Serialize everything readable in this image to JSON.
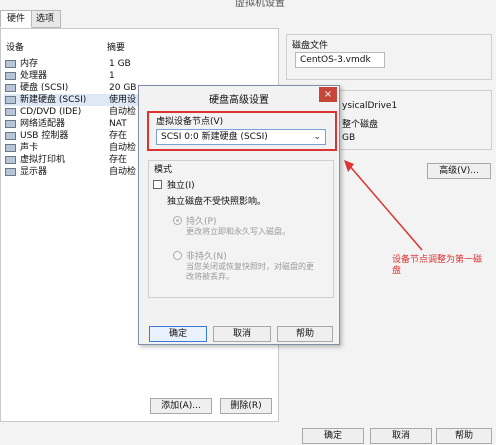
{
  "window": {
    "title": "虚拟机设置",
    "tabs": [
      "硬件",
      "选项"
    ]
  },
  "hardware": {
    "col_device": "设备",
    "col_summary": "摘要",
    "devices": [
      {
        "name": "内存",
        "summary": "1 GB",
        "icon": "memory-icon"
      },
      {
        "name": "处理器",
        "summary": "1",
        "icon": "cpu-icon"
      },
      {
        "name": "硬盘 (SCSI)",
        "summary": "20 GB",
        "icon": "hard-disk-icon"
      },
      {
        "name": "新建硬盘 (SCSI)",
        "summary": "使用设",
        "icon": "hard-disk-icon",
        "selected": true
      },
      {
        "name": "CD/DVD (IDE)",
        "summary": "自动检",
        "icon": "cd-dvd-icon"
      },
      {
        "name": "网络适配器",
        "summary": "NAT",
        "icon": "network-icon"
      },
      {
        "name": "USB 控制器",
        "summary": "存在",
        "icon": "usb-icon"
      },
      {
        "name": "声卡",
        "summary": "自动检",
        "icon": "sound-icon"
      },
      {
        "name": "虚拟打印机",
        "summary": "存在",
        "icon": "printer-icon"
      },
      {
        "name": "显示器",
        "summary": "自动检",
        "icon": "display-icon"
      }
    ],
    "add_button": "添加(A)...",
    "remove_button": "删除(R)"
  },
  "right": {
    "disk_file_label": "磁盘文件",
    "disk_file_value": "CentOS-3.vmdk",
    "physical_drive": "ysicalDrive1",
    "whole_disk": "整个磁盘",
    "gb": "GB",
    "advanced_button": "高级(V)..."
  },
  "dialog": {
    "title": "硬盘高级设置",
    "close": "×",
    "node_label": "虚拟设备节点(V)",
    "node_value": "SCSI 0:0  新建硬盘 (SCSI)",
    "mode_label": "模式",
    "independent_label": "独立(I)",
    "independent_desc": "独立磁盘不受快照影响。",
    "persistent_label": "持久(P)",
    "persistent_desc": "更改将立即和永久写入磁盘。",
    "nonpersistent_label": "非持久(N)",
    "nonpersistent_desc": "当您关闭或恢复快照时，对磁盘的更改将被丢弃。",
    "ok": "确定",
    "cancel": "取消",
    "help": "帮助"
  },
  "footer": {
    "ok": "确定",
    "cancel": "取消",
    "help": "帮助"
  },
  "annotation": {
    "text": "设备节点调整为第一磁盘"
  }
}
